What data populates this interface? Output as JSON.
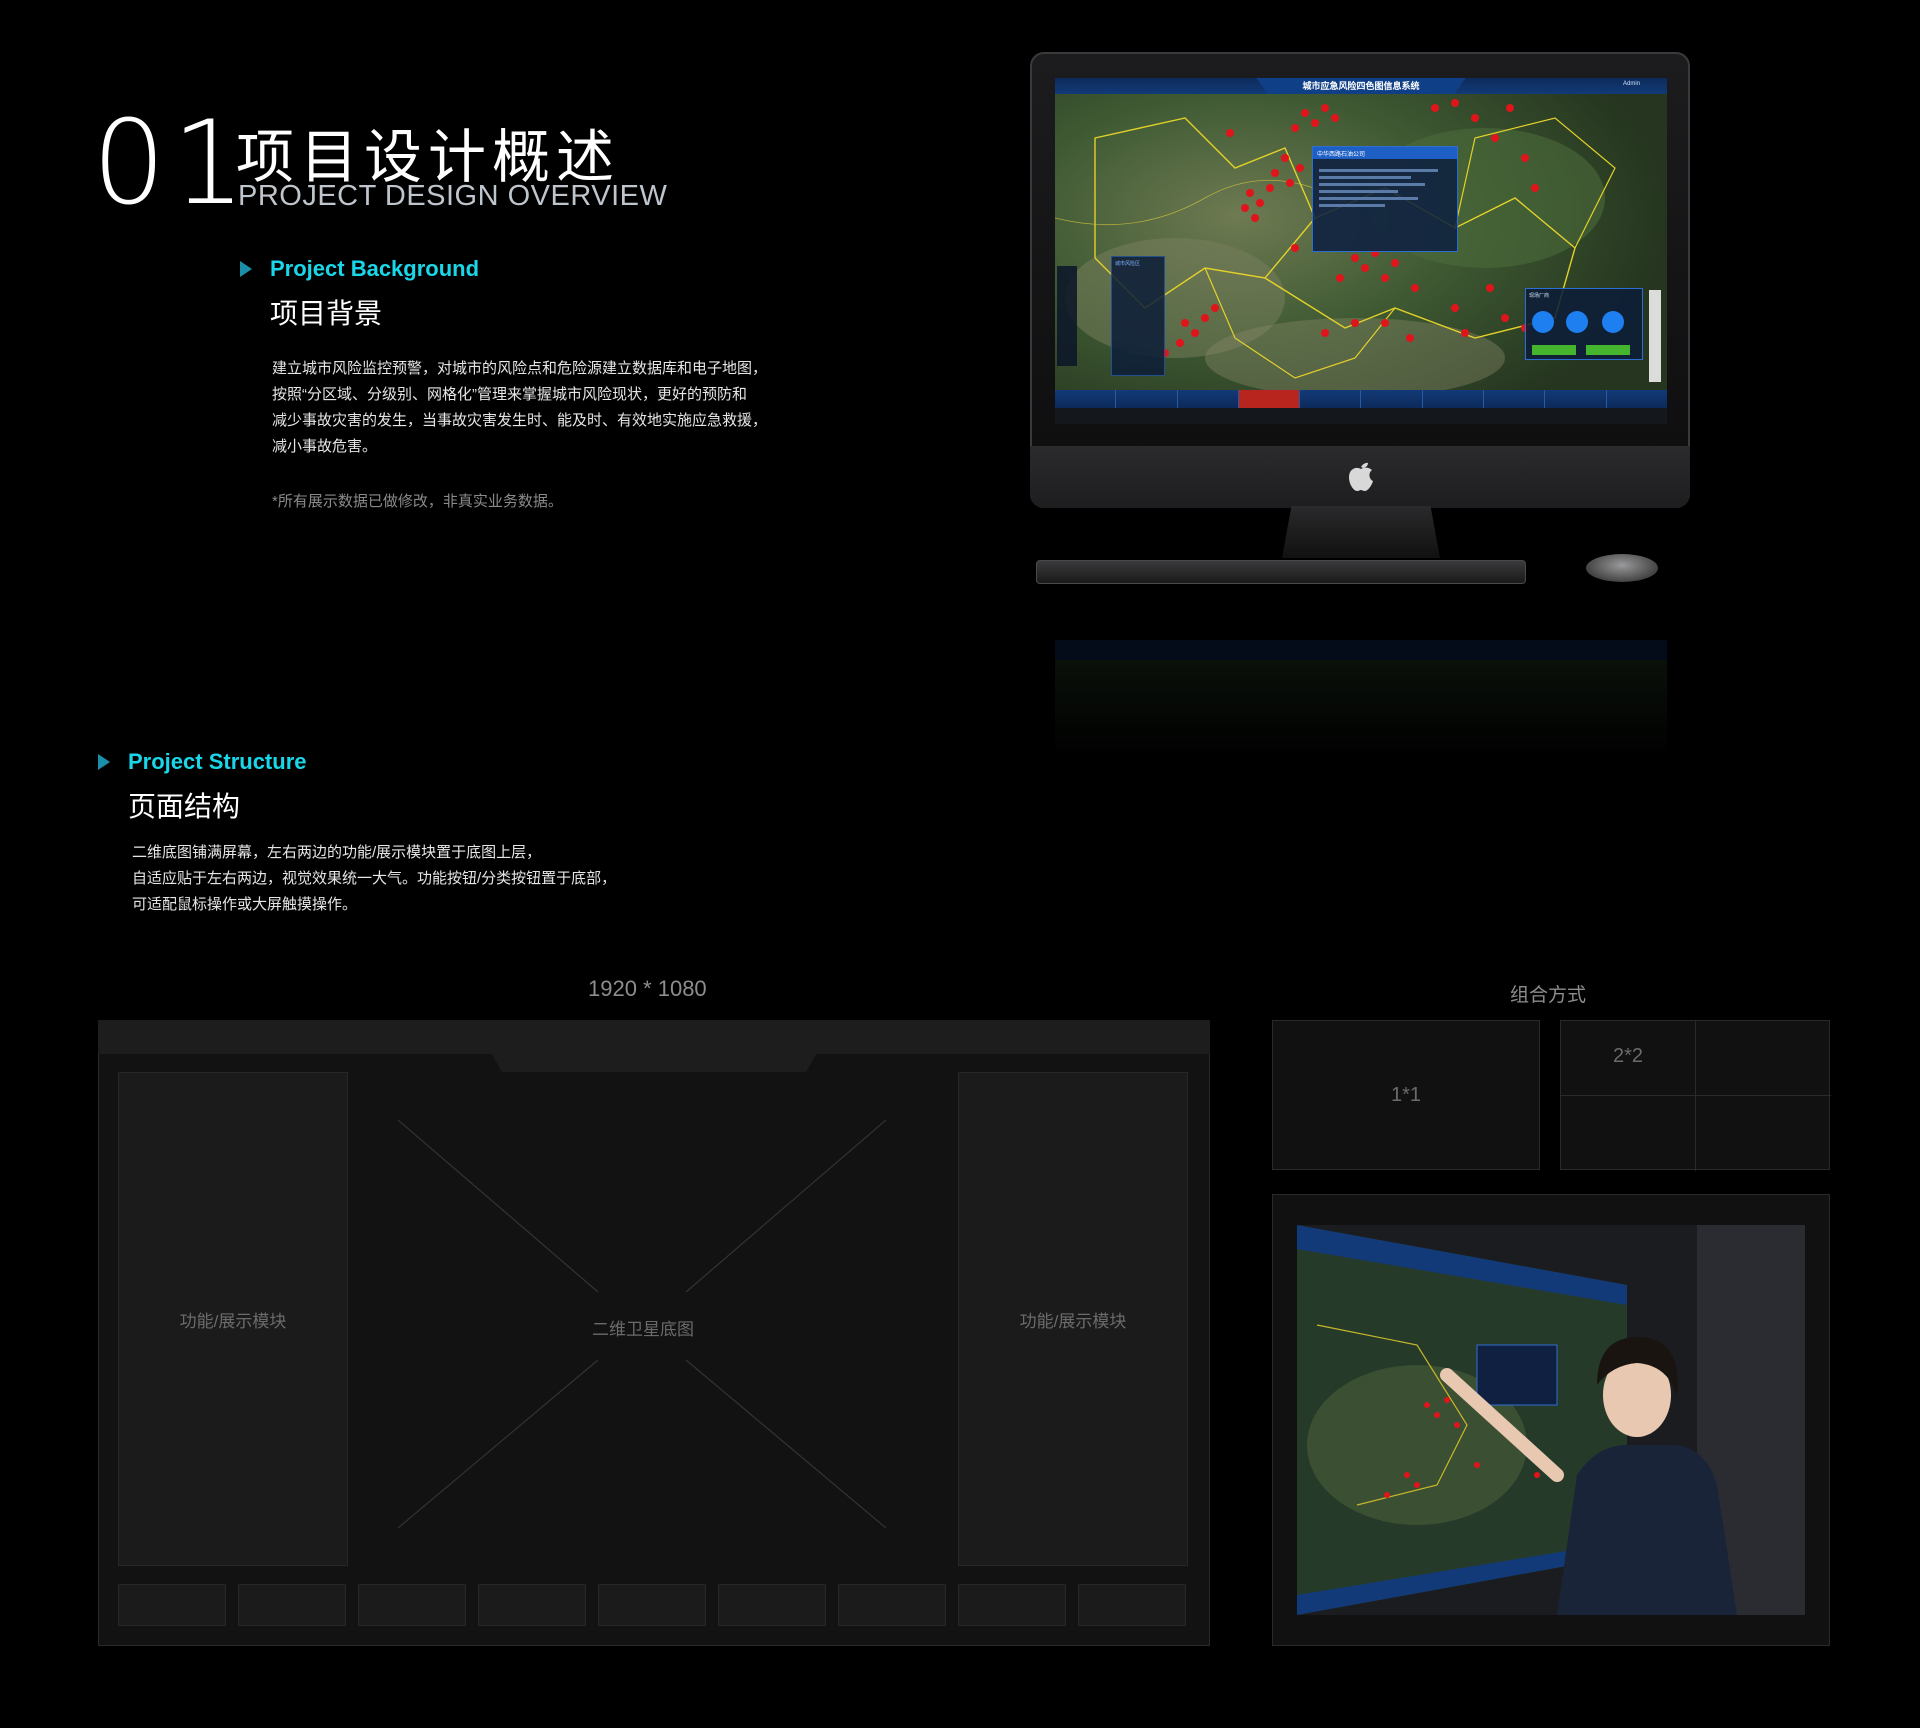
{
  "header": {
    "number": "01",
    "title_cn": "项目设计概述",
    "title_en": "PROJECT DESIGN OVERVIEW"
  },
  "background": {
    "title_en": "Project Background",
    "title_cn": "项目背景",
    "lines": [
      "建立城市风险监控预警，对城市的风险点和危险源建立数据库和电子地图，",
      "按照“分区域、分级别、网格化”管理来掌握城市风险现状，更好的预防和",
      "减少事故灾害的发生，当事故灾害发生时、能及时、有效地实施应急救援，",
      "减小事故危害。"
    ],
    "note": "*所有展示数据已做修改，非真实业务数据。"
  },
  "screen": {
    "system_title": "城市应急风险四色图信息系统",
    "user": "Admin",
    "popup_title": "中华西路石油公司",
    "panel_title": "城市风险区",
    "video_title": "现场厂商"
  },
  "structure": {
    "title_en": "Project Structure",
    "title_cn": "页面结构",
    "lines": [
      "二维底图铺满屏幕，左右两边的功能/展示模块置于底图上层，",
      "自适应贴于左右两边，视觉效果统一大气。功能按钮/分类按钮置于底部，",
      "可适配鼠标操作或大屏触摸操作。"
    ]
  },
  "wireframe": {
    "size_label": "1920 * 1080",
    "left_module": "功能/展示模块",
    "center": "二维卫星底图",
    "right_module": "功能/展示模块"
  },
  "combo": {
    "title": "组合方式",
    "one": "1*1",
    "two": "2*2"
  },
  "colors": {
    "accent": "#19d7e8",
    "arrow": "#1c8fa8",
    "marker": "#e0151c"
  }
}
